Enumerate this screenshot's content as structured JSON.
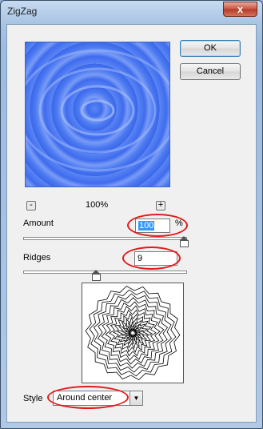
{
  "window": {
    "title": "ZigZag",
    "close_glyph": "x"
  },
  "buttons": {
    "ok": "OK",
    "cancel": "Cancel"
  },
  "zoom": {
    "minus": "-",
    "plus": "+",
    "value": "100%"
  },
  "amount": {
    "label": "Amount",
    "value": "100",
    "unit": "%",
    "slider_fraction": 1.0
  },
  "ridges": {
    "label": "Ridges",
    "value": "9",
    "slider_fraction": 0.45
  },
  "style": {
    "label": "Style",
    "selected": "Around center"
  },
  "colors": {
    "annotation_ring": "#e21a1a",
    "preview_blue": "#4d7bf1"
  }
}
